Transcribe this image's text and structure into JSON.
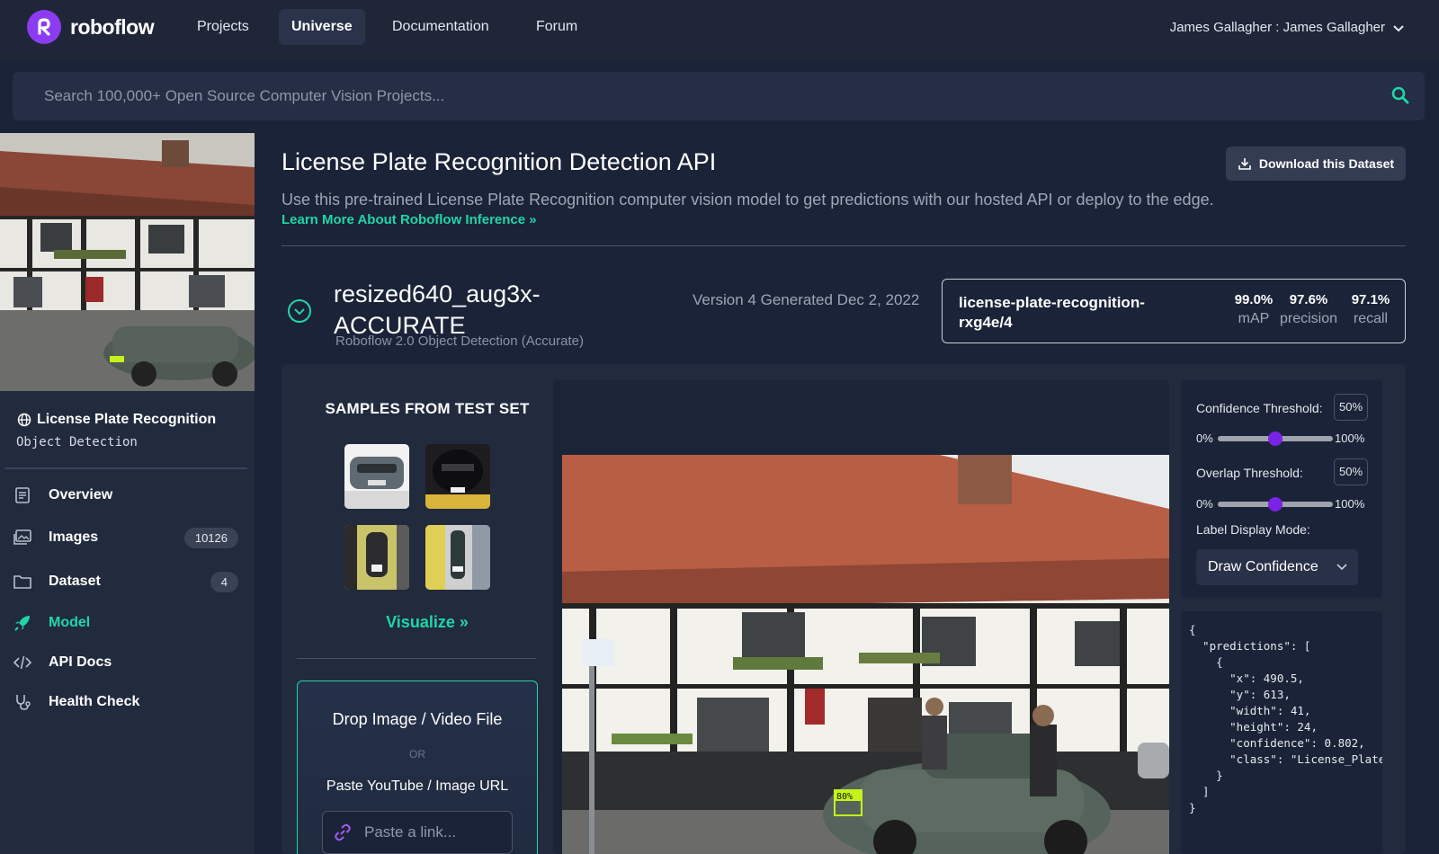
{
  "brand": {
    "name": "roboflow",
    "accent": "#20d6a6",
    "logo_color": "#8c3cf0"
  },
  "nav": {
    "items": [
      {
        "label": "Projects",
        "active": false
      },
      {
        "label": "Universe",
        "active": true
      },
      {
        "label": "Documentation",
        "active": false
      },
      {
        "label": "Forum",
        "active": false
      }
    ],
    "user": "James Gallagher : James Gallagher"
  },
  "search": {
    "placeholder": "Search 100,000+ Open Source Computer Vision Projects..."
  },
  "sidebar": {
    "project_title": "License Plate Recognition",
    "project_type": "Object Detection",
    "items": [
      {
        "label": "Overview",
        "icon": "document-icon",
        "badge": null,
        "active": false
      },
      {
        "label": "Images",
        "icon": "images-icon",
        "badge": "10126",
        "active": false
      },
      {
        "label": "Dataset",
        "icon": "folder-icon",
        "badge": "4",
        "active": false
      },
      {
        "label": "Model",
        "icon": "rocket-icon",
        "badge": null,
        "active": true
      },
      {
        "label": "API Docs",
        "icon": "code-icon",
        "badge": null,
        "active": false
      },
      {
        "label": "Health Check",
        "icon": "stethoscope-icon",
        "badge": null,
        "active": false
      }
    ]
  },
  "header": {
    "title": "License Plate Recognition Detection API",
    "download_label": "Download this Dataset",
    "description": "Use this pre-trained License Plate Recognition computer vision model to get predictions with our hosted API or deploy to the edge.",
    "learn_more": "Learn More About Roboflow Inference »"
  },
  "version": {
    "name": "resized640_aug3x-ACCURATE",
    "subtitle": "Roboflow 2.0 Object Detection (Accurate)",
    "meta": "Version 4 Generated Dec 2, 2022",
    "model_id": "license-plate-recognition-rxg4e/4",
    "metrics": [
      {
        "value": "99.0%",
        "label": "mAP"
      },
      {
        "value": "97.6%",
        "label": "precision"
      },
      {
        "value": "97.1%",
        "label": "recall"
      }
    ]
  },
  "samples": {
    "title": "SAMPLES FROM TEST SET",
    "visualize": "Visualize »"
  },
  "upload": {
    "title": "Drop Image / Video File",
    "or": "OR",
    "paste_label": "Paste YouTube / Image URL",
    "link_placeholder": "Paste a link..."
  },
  "controls": {
    "confidence_label": "Confidence Threshold:",
    "confidence_value": "50%",
    "confidence_level": 0.5,
    "overlap_label": "Overlap Threshold:",
    "overlap_value": "50%",
    "overlap_level": 0.5,
    "min_label": "0%",
    "max_label": "100%",
    "label_mode_label": "Label Display Mode:",
    "label_mode_value": "Draw Confidence"
  },
  "detection": {
    "label": "80%"
  },
  "json_output": "{\n  \"predictions\": [\n    {\n      \"x\": 490.5,\n      \"y\": 613,\n      \"width\": 41,\n      \"height\": 24,\n      \"confidence\": 0.802,\n      \"class\": \"License_Plate\"\n    }\n  ]\n}"
}
